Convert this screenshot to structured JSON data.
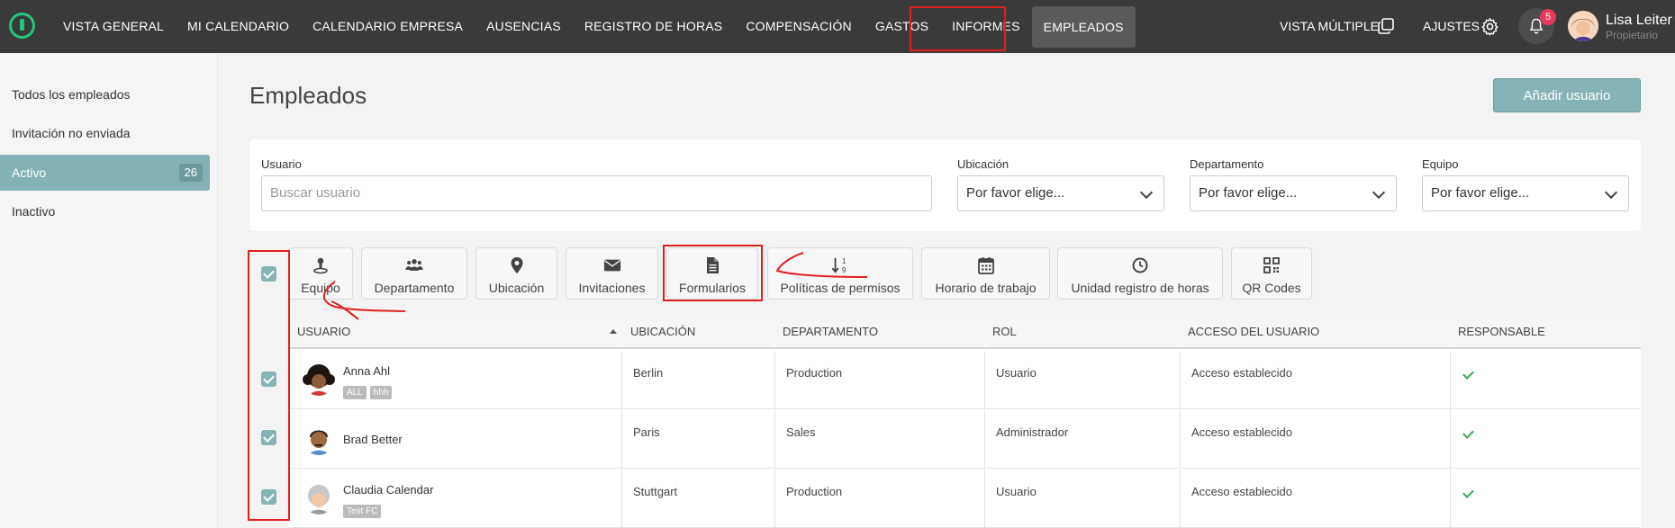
{
  "nav": {
    "items": [
      "VISTA GENERAL",
      "MI CALENDARIO",
      "CALENDARIO EMPRESA",
      "AUSENCIAS",
      "REGISTRO DE HORAS",
      "COMPENSACIÓN",
      "GASTOS",
      "INFORMES",
      "EMPLEADOS"
    ],
    "active": "EMPLEADOS",
    "multi_view": "VISTA MÚLTIPLE",
    "settings": "AJUSTES",
    "notifications_count": "5",
    "user_name": "Lisa Leiter",
    "user_role": "Propietario",
    "logo_color": "#21c87a",
    "icons": {
      "multi_view": "copy-icon",
      "settings": "gear-icon",
      "notifications": "bell-icon"
    }
  },
  "sidebar": {
    "items": [
      {
        "label": "Todos los empleados"
      },
      {
        "label": "Invitación no enviada"
      },
      {
        "label": "Activo",
        "count": "26",
        "active": true
      },
      {
        "label": "Inactivo"
      }
    ]
  },
  "page": {
    "title": "Empleados",
    "add_user": "Añadir usuario",
    "accent": "#86b4b6"
  },
  "filters": {
    "user_label": "Usuario",
    "user_placeholder": "Buscar usuario",
    "location_label": "Ubicación",
    "location_value": "Por favor elige...",
    "department_label": "Departamento",
    "department_value": "Por favor elige...",
    "team_label": "Equipo",
    "team_value": "Por favor elige..."
  },
  "toolbar": {
    "buttons": [
      {
        "label": "Equipo",
        "icon": "team-icon"
      },
      {
        "label": "Departamento",
        "icon": "users-icon"
      },
      {
        "label": "Ubicación",
        "icon": "map-pin-icon"
      },
      {
        "label": "Invitaciones",
        "icon": "envelope-icon"
      },
      {
        "label": "Formularios",
        "icon": "document-icon"
      },
      {
        "label": "Políticas de permisos",
        "icon": "sort-numeric-icon"
      },
      {
        "label": "Horario de trabajo",
        "icon": "calendar-icon"
      },
      {
        "label": "Unidad registro de horas",
        "icon": "clock-icon"
      },
      {
        "label": "QR Codes",
        "icon": "qr-code-icon"
      }
    ]
  },
  "table": {
    "headers": [
      "USUARIO",
      "UBICACIÓN",
      "DEPARTAMENTO",
      "ROL",
      "ACCESO DEL USUARIO",
      "RESPONSABLE"
    ],
    "rows": [
      {
        "name": "Anna Ahl",
        "tags": [
          "ALL",
          "hhh"
        ],
        "location": "Berlin",
        "department": "Production",
        "role": "Usuario",
        "access": "Acceso establecido",
        "responsible": true
      },
      {
        "name": "Brad Better",
        "tags": [],
        "location": "Paris",
        "department": "Sales",
        "role": "Administrador",
        "access": "Acceso establecido",
        "responsible": true
      },
      {
        "name": "Claudia Calendar",
        "tags": [
          "Test FC"
        ],
        "location": "Stuttgart",
        "department": "Production",
        "role": "Usuario",
        "access": "Acceso establecido",
        "responsible": true
      }
    ]
  }
}
